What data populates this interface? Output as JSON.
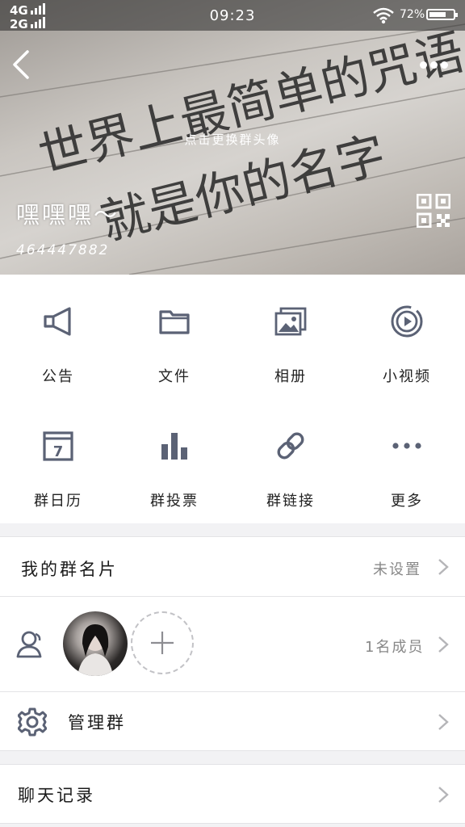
{
  "status_bar": {
    "network_1": "4G",
    "network_2": "2G",
    "time": "09:23",
    "battery": "72%",
    "battery_level": 0.72
  },
  "header": {
    "background_text_1": "世界上最简单的咒语",
    "background_text_2": "就是你的名字",
    "avatar_hint": "点击更换群头像",
    "group_name": "嘿嘿嘿～",
    "group_id": "464447882"
  },
  "features": [
    {
      "label": "公告",
      "icon": "megaphone-icon"
    },
    {
      "label": "文件",
      "icon": "folder-icon"
    },
    {
      "label": "相册",
      "icon": "album-icon"
    },
    {
      "label": "小视频",
      "icon": "video-icon"
    },
    {
      "label": "群日历",
      "icon": "calendar-icon"
    },
    {
      "label": "群投票",
      "icon": "bar-chart-icon"
    },
    {
      "label": "群链接",
      "icon": "link-icon"
    },
    {
      "label": "更多",
      "icon": "more-dots-icon"
    }
  ],
  "calendar_day": "7",
  "group_card": {
    "label": "我的群名片",
    "value": "未设置"
  },
  "members": {
    "count_text": "1名成员"
  },
  "manage": {
    "label": "管理群"
  },
  "chat_history": {
    "label": "聊天记录"
  },
  "colors": {
    "icon": "#5b6275",
    "accent": "#ffffff",
    "background": "#f2f2f4"
  }
}
